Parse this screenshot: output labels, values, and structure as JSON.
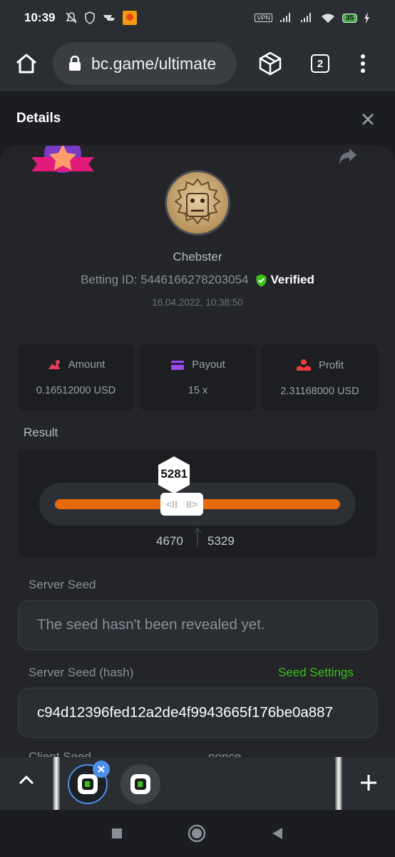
{
  "status_bar": {
    "time": "10:39",
    "vpn_label": "VPN",
    "battery": "35",
    "left_icons": [
      "mute-icon",
      "shield-icon",
      "app-icon",
      "app-icon-orange"
    ],
    "right_icons": [
      "signal-icon",
      "signal-icon",
      "wifi-icon",
      "battery-icon",
      "charging-icon"
    ]
  },
  "browser": {
    "url": "bc.game/ultimate",
    "tab_count": "2"
  },
  "details": {
    "title": "Details"
  },
  "bet": {
    "username": "Chebster",
    "betting_id_label": "Betting ID: 5446166278203054",
    "verified_label": "Verified",
    "date": "16.04.2022, 10:38:50",
    "amount_label": "Amount",
    "amount_value": "0.16512000 USD",
    "payout_label": "Payout",
    "payout_value": "15 x",
    "profit_label": "Profit",
    "profit_value": "2.31168000 USD"
  },
  "result": {
    "label": "Result",
    "value": "5281",
    "range_low": "4670",
    "range_high": "5329",
    "range_low_fraction": 0.467,
    "range_high_fraction": 0.5329,
    "value_fraction": 0.5281,
    "fill_color": "#e8690c"
  },
  "server_seed": {
    "label": "Server Seed",
    "value": "The seed hasn't been revealed yet."
  },
  "server_seed_hash": {
    "label": "Server Seed (hash)",
    "settings_link": "Seed Settings",
    "value": "c94d12396fed12a2de4f9943665f176be0a887"
  },
  "client_seed": {
    "label": "Client Seed",
    "nonce_label": "nonce"
  },
  "colors": {
    "accent_green": "#3bc117",
    "accent_orange": "#e8690c",
    "tab_highlight": "#4f8fe8"
  }
}
